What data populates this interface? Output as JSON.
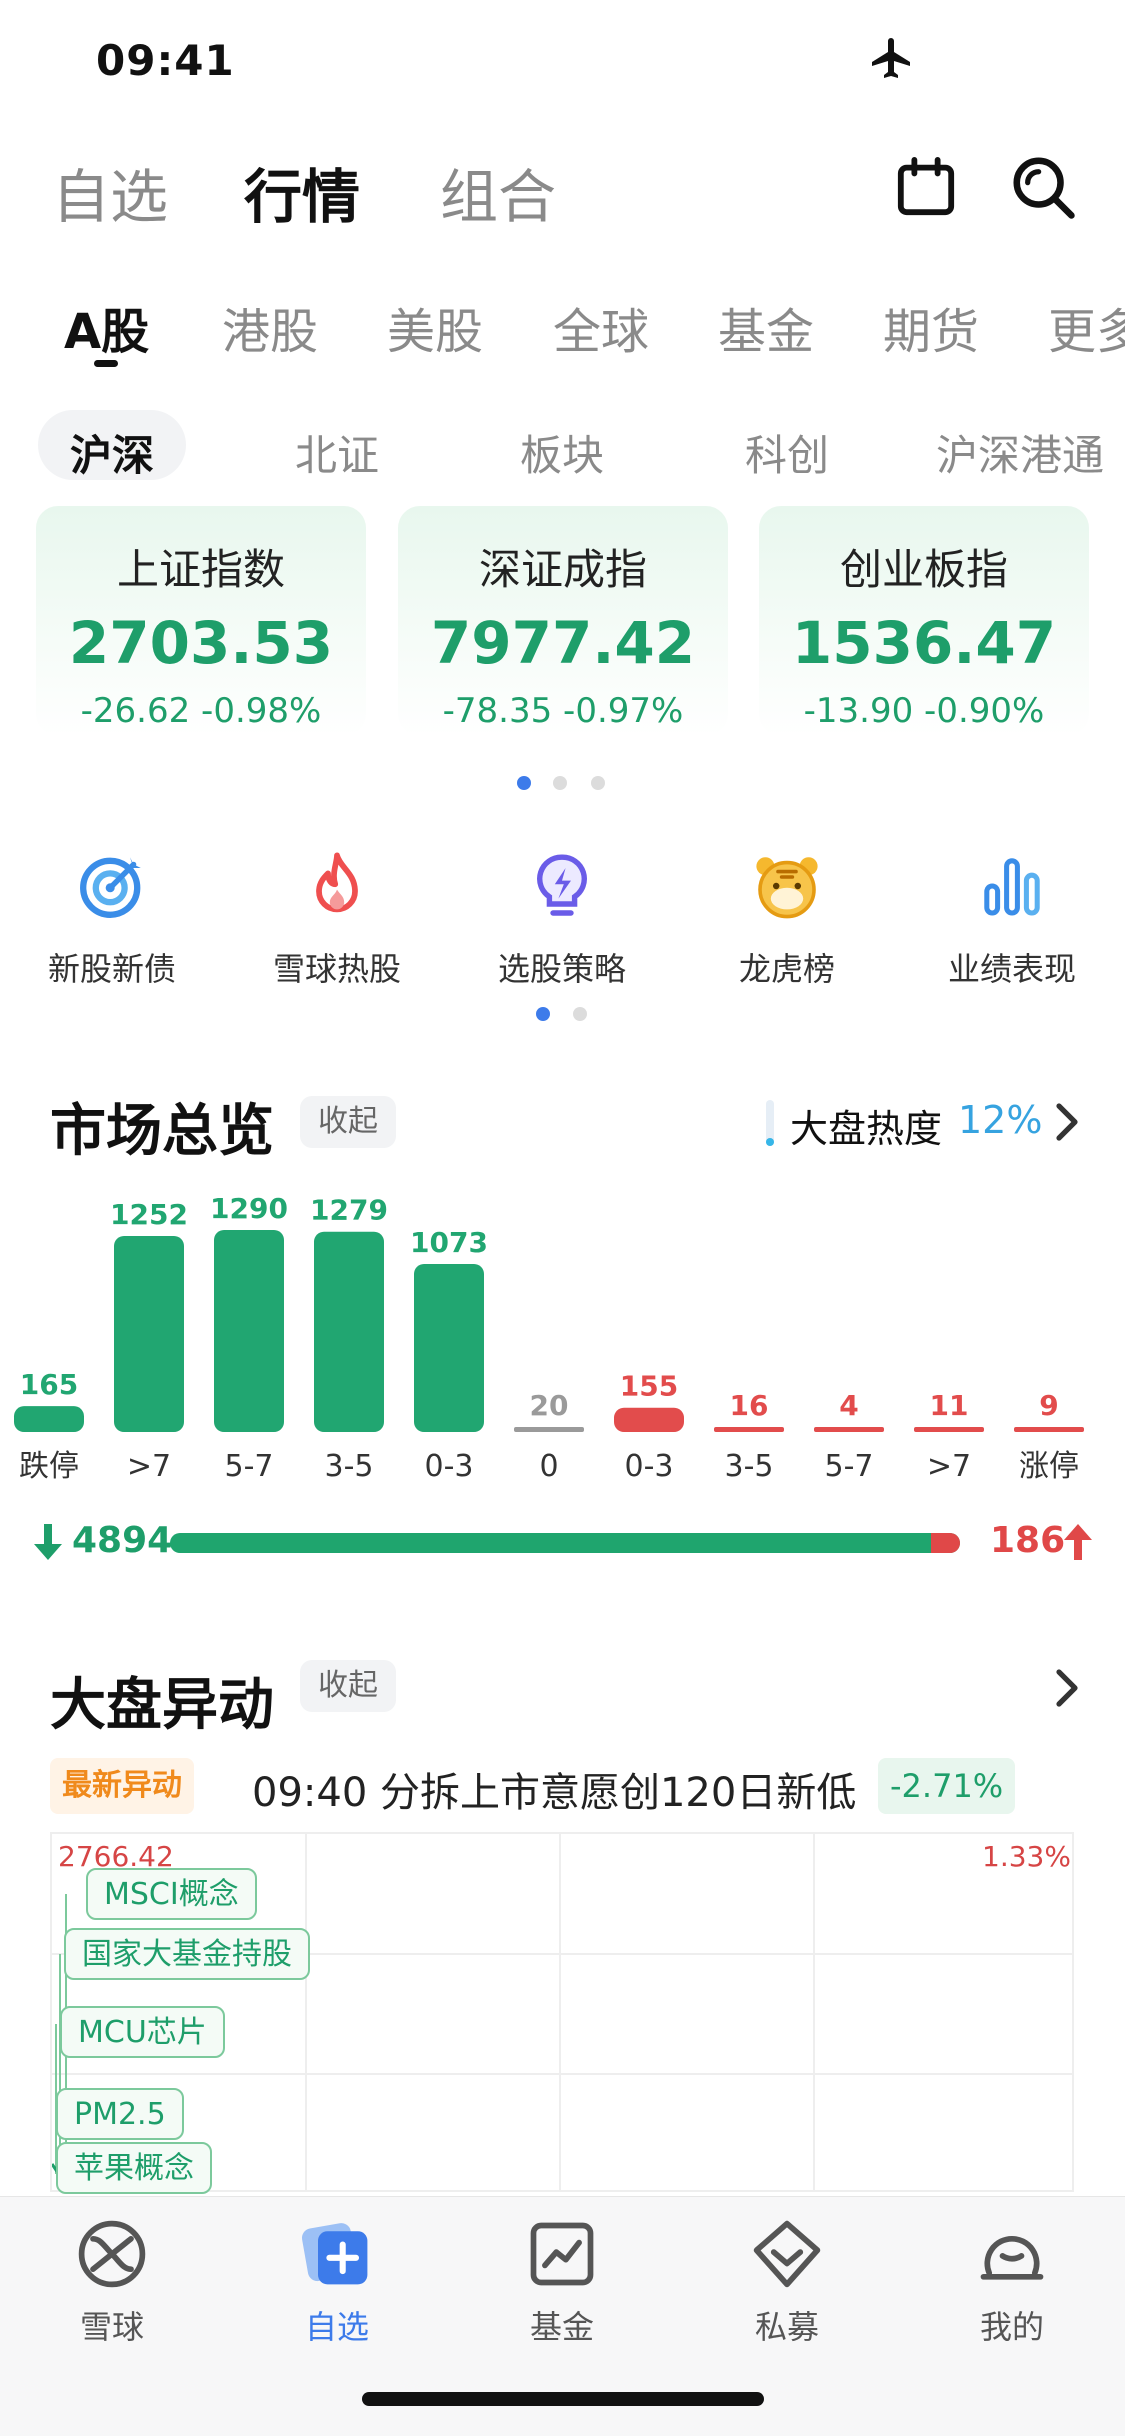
{
  "status_bar": {
    "time": "09:41"
  },
  "top_nav": {
    "tabs": [
      "自选",
      "行情",
      "组合"
    ],
    "active": 1
  },
  "market_tabs": {
    "tabs": [
      "A股",
      "港股",
      "美股",
      "全球",
      "基金",
      "期货",
      "更多"
    ],
    "active": 0
  },
  "sub_tabs": {
    "tabs": [
      "沪深",
      "北证",
      "板块",
      "科创",
      "沪深港通"
    ],
    "active": 0
  },
  "index_cards": [
    {
      "name": "上证指数",
      "value": "2703.53",
      "change": "-26.62 -0.98%"
    },
    {
      "name": "深证成指",
      "value": "7977.42",
      "change": "-78.35 -0.97%"
    },
    {
      "name": "创业板指",
      "value": "1536.47",
      "change": "-13.90 -0.90%"
    }
  ],
  "shortcuts": [
    {
      "label": "新股新债",
      "icon": "target-icon"
    },
    {
      "label": "雪球热股",
      "icon": "flame-icon"
    },
    {
      "label": "选股策略",
      "icon": "lightbulb-icon"
    },
    {
      "label": "龙虎榜",
      "icon": "tiger-icon"
    },
    {
      "label": "业绩表现",
      "icon": "bar-chart-icon"
    }
  ],
  "market_overview": {
    "title": "市场总览",
    "collapse_label": "收起",
    "heat_label": "大盘热度",
    "heat_value": "12%",
    "heat_level": 0.12
  },
  "chart_data": {
    "type": "bar",
    "categories": [
      "跌停",
      ">7",
      "5-7",
      "3-5",
      "0-3",
      "0",
      "0-3",
      "3-5",
      "5-7",
      ">7",
      "涨停"
    ],
    "values": [
      165,
      1252,
      1290,
      1279,
      1073,
      20,
      155,
      16,
      4,
      11,
      9
    ],
    "bar_colors": [
      "#21a671",
      "#21a671",
      "#21a671",
      "#21a671",
      "#21a671",
      "#9a9a9a",
      "#e24c4c",
      "#e24c4c",
      "#e24c4c",
      "#e24c4c",
      "#e24c4c"
    ],
    "ylim": [
      0,
      1290
    ]
  },
  "updown": {
    "down": "4894",
    "up": "186",
    "down_value": 4894,
    "up_value": 186
  },
  "anomaly": {
    "title": "大盘异动",
    "collapse_label": "收起",
    "tag": "最新异动",
    "text": "09:40 分拆上市意愿创120日新低",
    "pct": "-2.71%",
    "top_price": "2766.42",
    "top_pct": "1.33%",
    "concept_tags": [
      "MSCI概念",
      "国家大基金持股",
      "MCU芯片",
      "PM2.5",
      "苹果概念"
    ]
  },
  "bottom_tabs": {
    "items": [
      {
        "label": "雪球",
        "icon": "snowball-icon"
      },
      {
        "label": "自选",
        "icon": "watchlist-icon"
      },
      {
        "label": "基金",
        "icon": "fund-chart-icon"
      },
      {
        "label": "私募",
        "icon": "private-fund-icon"
      },
      {
        "label": "我的",
        "icon": "profile-icon"
      }
    ],
    "active": 1
  },
  "colors": {
    "green": "#1e9e6a",
    "red": "#e04848",
    "blue": "#3d7bea",
    "orange": "#f08a1c"
  }
}
